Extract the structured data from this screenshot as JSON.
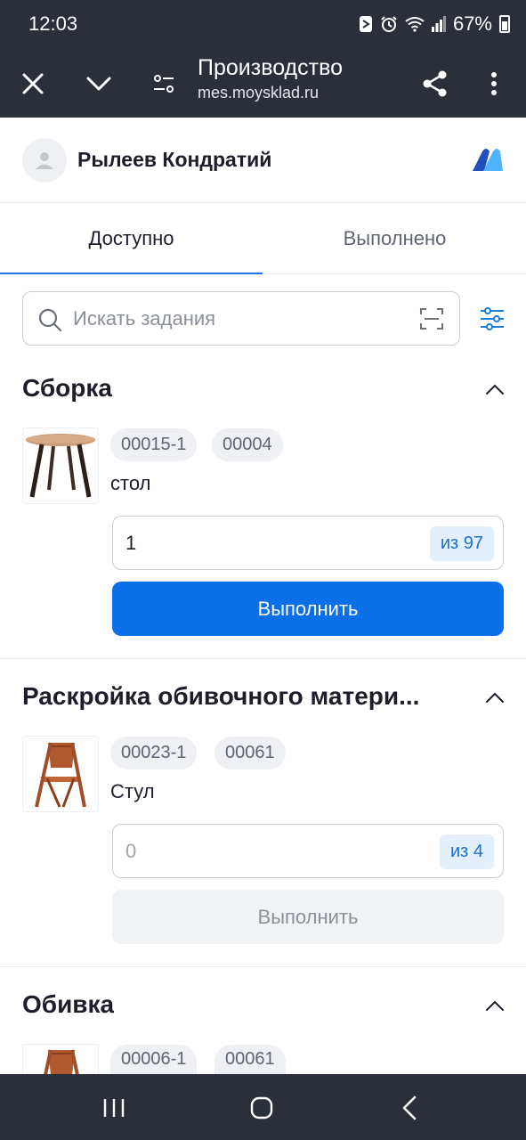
{
  "status_bar": {
    "time": "12:03",
    "battery": "67%"
  },
  "browser": {
    "title": "Производство",
    "url": "mes.moysklad.ru"
  },
  "user": {
    "name": "Рылеев Кондратий"
  },
  "tabs": [
    {
      "label": "Доступно",
      "active": true
    },
    {
      "label": "Выполнено",
      "active": false
    }
  ],
  "search": {
    "placeholder": "Искать задания"
  },
  "sections": [
    {
      "title": "Сборка",
      "item": {
        "codes": [
          "00015-1",
          "00004"
        ],
        "name": "стол",
        "quantity": "1",
        "of": "из 97",
        "button": "Выполнить",
        "button_enabled": true
      }
    },
    {
      "title": "Раскройка обивочного матери...",
      "item": {
        "codes": [
          "00023-1",
          "00061"
        ],
        "name": "Стул",
        "quantity": "0",
        "of": "из 4",
        "button": "Выполнить",
        "button_enabled": false
      }
    },
    {
      "title": "Обивка",
      "item": {
        "codes": [
          "00006-1",
          "00061"
        ]
      }
    }
  ],
  "colors": {
    "accent": "#0b6fe8",
    "tab_underline": "#1f73e8",
    "chrome": "#2b2f3a"
  }
}
